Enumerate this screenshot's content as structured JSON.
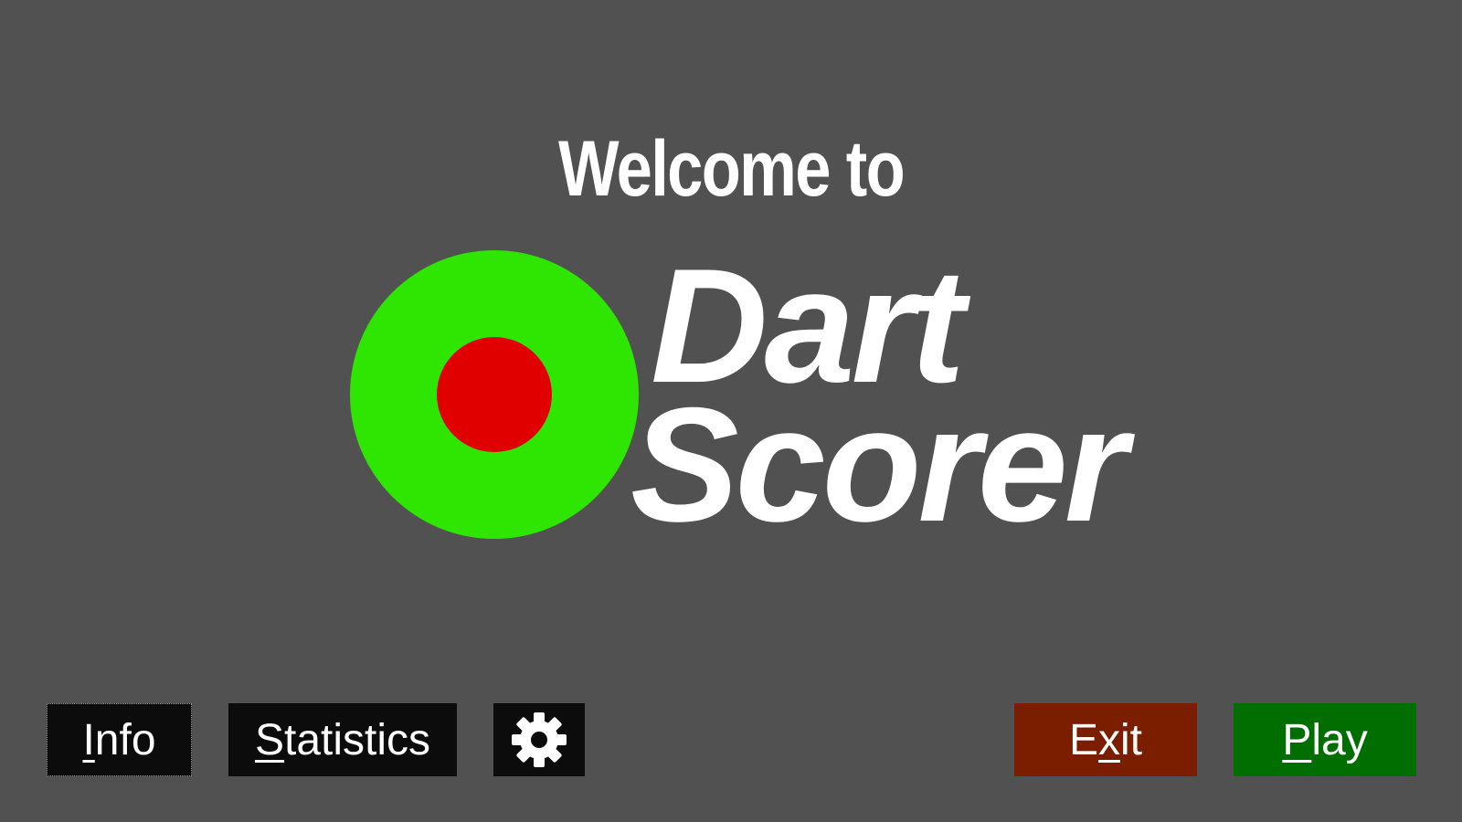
{
  "welcome_text": "Welcome to",
  "logo": {
    "title_line1": "Dart",
    "title_line2": "Scorer",
    "outer_color": "#2fe502",
    "inner_color": "#e00000",
    "text_color": "#ffffff"
  },
  "buttons": {
    "info": {
      "mnemonic": "I",
      "rest": "nfo"
    },
    "statistics": {
      "mnemonic": "S",
      "rest": "tatistics"
    },
    "settings": {
      "icon": "gear-icon"
    },
    "exit": {
      "pre": "E",
      "mnemonic": "x",
      "rest": "it"
    },
    "play": {
      "mnemonic": "P",
      "rest": "lay"
    }
  },
  "colors": {
    "background": "#515151",
    "dark_button": "#0c0c0c",
    "exit_button": "#7b1e00",
    "play_button": "#006e00"
  }
}
